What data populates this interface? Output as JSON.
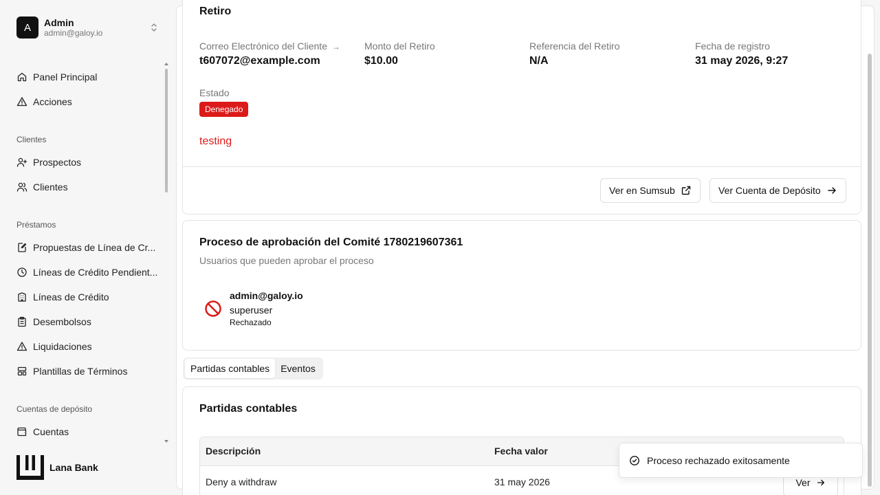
{
  "account": {
    "initial": "A",
    "name": "Admin",
    "email": "admin@galoy.io"
  },
  "nav": {
    "top": [
      {
        "label": "Panel Principal",
        "icon": "home-icon"
      },
      {
        "label": "Acciones",
        "icon": "alert-triangle-icon"
      }
    ],
    "groups": [
      {
        "title": "Clientes",
        "items": [
          {
            "label": "Prospectos",
            "icon": "user-plus-icon"
          },
          {
            "label": "Clientes",
            "icon": "users-icon"
          }
        ]
      },
      {
        "title": "Préstamos",
        "items": [
          {
            "label": "Propuestas de Línea de Cr...",
            "icon": "file-edit-icon"
          },
          {
            "label": "Líneas de Crédito Pendient...",
            "icon": "clock-icon"
          },
          {
            "label": "Líneas de Crédito",
            "icon": "bank-icon"
          },
          {
            "label": "Desembolsos",
            "icon": "clipboard-icon"
          },
          {
            "label": "Liquidaciones",
            "icon": "alert-triangle-icon"
          },
          {
            "label": "Plantillas de Términos",
            "icon": "layout-icon"
          }
        ]
      },
      {
        "title": "Cuentas de depósito",
        "items": [
          {
            "label": "Cuentas",
            "icon": "wallet-icon"
          }
        ]
      }
    ]
  },
  "brand": {
    "name": "Lana Bank"
  },
  "withdrawal": {
    "title": "Retiro",
    "email_label": "Correo Electrónico del Cliente",
    "email_value": "t607072@example.com",
    "amount_label": "Monto del Retiro",
    "amount_value": "$10.00",
    "reference_label": "Referencia del Retiro",
    "reference_value": "N/A",
    "date_label": "Fecha de registro",
    "date_value": "31 may 2026, 9:27",
    "status_label": "Estado",
    "status_value": "Denegado",
    "reason": "testing",
    "sumsub_button": "Ver en Sumsub",
    "deposit_button": "Ver Cuenta de Depósito"
  },
  "approval": {
    "title": "Proceso de aprobación del Comité 1780219607361",
    "subtitle": "Usuarios que pueden aprobar el proceso",
    "voter_email": "admin@galoy.io",
    "voter_role": "superuser",
    "voter_status": "Rechazado"
  },
  "tabs": [
    "Partidas contables",
    "Eventos"
  ],
  "ledger": {
    "title": "Partidas contables",
    "columns": [
      "Descripción",
      "Fecha valor"
    ],
    "rows": [
      {
        "description": "Deny a withdraw",
        "date": "31 may 2026",
        "action": "Ver"
      }
    ]
  },
  "toast": {
    "message": "Proceso rechazado exitosamente"
  },
  "colors": {
    "danger": "#dc1a1a",
    "background": "#f6f6f6"
  }
}
